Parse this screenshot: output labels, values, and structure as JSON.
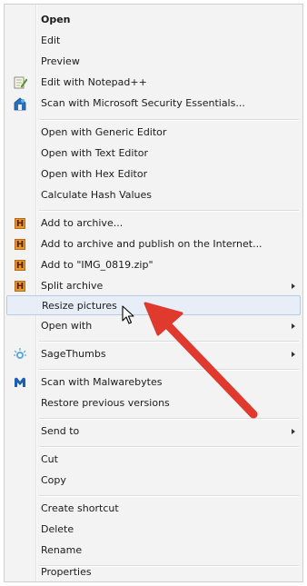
{
  "context_menu": {
    "items": [
      {
        "label": "Open",
        "bold": true
      },
      {
        "label": "Edit"
      },
      {
        "label": "Preview"
      },
      {
        "label": "Edit with Notepad++",
        "icon": "notepad-plus-plus-icon"
      },
      {
        "label": "Scan with Microsoft Security Essentials...",
        "icon": "security-essentials-icon"
      },
      {
        "label": "Open with Generic Editor"
      },
      {
        "label": "Open with Text Editor"
      },
      {
        "label": "Open with Hex Editor"
      },
      {
        "label": "Calculate Hash Values"
      },
      {
        "label": "Add to archive...",
        "icon": "archive-icon",
        "icon_text": "H"
      },
      {
        "label": "Add to archive and publish on the Internet...",
        "icon": "archive-icon",
        "icon_text": "H"
      },
      {
        "label": "Add to \"IMG_0819.zip\"",
        "icon": "archive-icon",
        "icon_text": "H"
      },
      {
        "label": "Split archive",
        "icon": "archive-icon",
        "icon_text": "H",
        "submenu": true
      },
      {
        "label": "Resize pictures",
        "highlighted": true
      },
      {
        "label": "Open with",
        "submenu": true
      },
      {
        "label": "SageThumbs",
        "icon": "sagethumbs-icon",
        "submenu": true
      },
      {
        "label": "Scan with Malwarebytes",
        "icon": "malwarebytes-icon"
      },
      {
        "label": "Restore previous versions"
      },
      {
        "label": "Send to",
        "submenu": true
      },
      {
        "label": "Cut"
      },
      {
        "label": "Copy"
      },
      {
        "label": "Create shortcut"
      },
      {
        "label": "Delete"
      },
      {
        "label": "Rename"
      },
      {
        "label": "Properties"
      }
    ]
  },
  "colors": {
    "menu_background": "#f3f3f3",
    "highlight_background": "#e8eef7",
    "highlight_border": "#b8cbe5",
    "annotation_arrow": "#e03a2f"
  }
}
